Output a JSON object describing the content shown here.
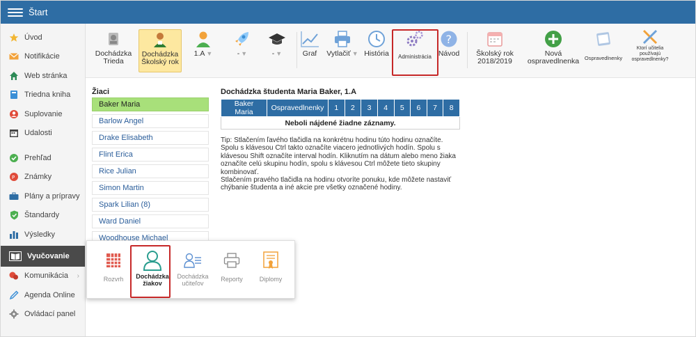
{
  "header": {
    "title": "Štart"
  },
  "sidebar": {
    "items": [
      {
        "label": "Úvod",
        "icon": "star-icon"
      },
      {
        "label": "Notifikácie",
        "icon": "envelope-icon"
      },
      {
        "label": "Web stránka",
        "icon": "home-icon"
      },
      {
        "label": "Triedna kniha",
        "icon": "book-icon"
      },
      {
        "label": "Suplovanie",
        "icon": "substitution-icon"
      },
      {
        "label": "Udalosti",
        "icon": "calendar-icon"
      },
      {
        "label": "Prehľad",
        "icon": "check-circle-icon"
      },
      {
        "label": "Známky",
        "icon": "grades-icon"
      },
      {
        "label": "Plány a prípravy",
        "icon": "briefcase-icon"
      },
      {
        "label": "Štandardy",
        "icon": "shield-icon"
      },
      {
        "label": "Výsledky",
        "icon": "bar-chart-icon"
      },
      {
        "label": "Vyučovanie",
        "icon": "open-book-icon"
      },
      {
        "label": "Komunikácia",
        "icon": "chat-icon"
      },
      {
        "label": "Agenda Online",
        "icon": "pen-icon"
      },
      {
        "label": "Ovládací panel",
        "icon": "gear-icon"
      }
    ]
  },
  "toolbar": {
    "dochadzka_trieda": "Dochádzka\nTrieda",
    "dochadzka_rok": "Dochádzka\nŠkolský rok",
    "class_select": "1.A",
    "select2": "-",
    "select3": "-",
    "graf": "Graf",
    "vytlacit": "Vytlačiť",
    "historia": "História",
    "administracia": "Administrácia",
    "navod": "Návod",
    "skolsky_rok": "Školský rok\n2018/2019",
    "nova": "Nová\nospravedlnenka",
    "ospravedlnenky": "Ospravedlnenky",
    "ktori": "Ktorí učitelia\npoužívajú\nospravedlnenky?"
  },
  "students": {
    "title": "Žiaci",
    "list": [
      "Baker Maria",
      "Barlow Angel",
      "Drake Elisabeth",
      "Flint Erica",
      "Rice Julian",
      "Simon Martin",
      "Spark Lilian (8)",
      "Ward Daniel",
      "Woodhouse Michael"
    ]
  },
  "attendance": {
    "title": "Dochádzka študenta Maria Baker, 1.A",
    "headers": [
      "Baker Maria",
      "Ospravedlnenky",
      "1",
      "2",
      "3",
      "4",
      "5",
      "6",
      "7",
      "8"
    ],
    "empty": "Neboli nájdené žiadne záznamy.",
    "tip": "Tip: Stlačením ľavého tlačidla na konkrétnu hodinu túto hodinu označíte. Spolu s klávesou Ctrl takto označíte viacero jednotlivých hodín. Spolu s klávesou Shift označíte interval hodín. Kliknutím na dátum alebo meno žiaka označíte celú skupinu hodín, spolu s klávesou Ctrl môžete tieto skupiny kombinovať.\nStlačením pravého tlačidla na hodinu otvoríte ponuku, kde môžete nastaviť chýbanie študenta a iné akcie pre všetky označené hodiny."
  },
  "popup": {
    "items": [
      {
        "label": "Rozvrh"
      },
      {
        "label": "Dochádzka\nžiakov"
      },
      {
        "label": "Dochádzka\nučiteľov"
      },
      {
        "label": "Reporty"
      },
      {
        "label": "Diplomy"
      }
    ]
  },
  "colors": {
    "header": "#2e6da4",
    "selected_student": "#a8e07a",
    "highlight": "#c62828",
    "selected_tool": "#fde8a0"
  }
}
